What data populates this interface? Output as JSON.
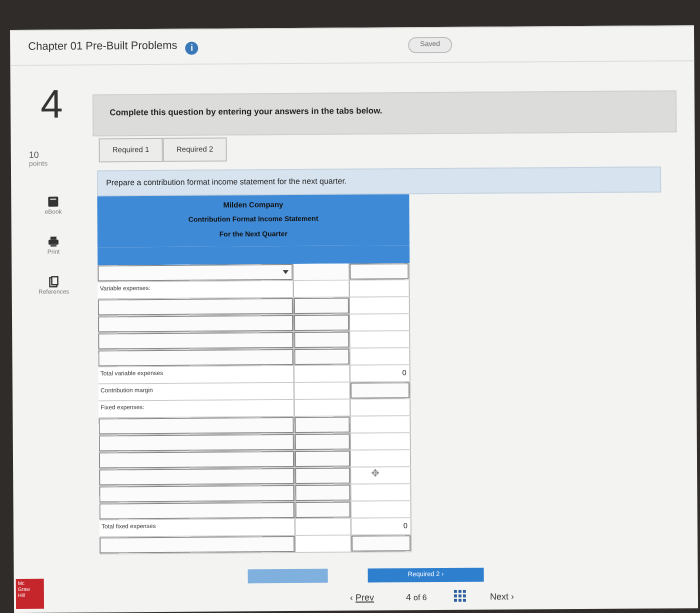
{
  "header": {
    "chapter_title": "Chapter 01 Pre-Built Problems",
    "info_icon": "i",
    "saved_label": "Saved"
  },
  "question": {
    "number": "4",
    "points_value": "10",
    "points_label": "points"
  },
  "sidebar": {
    "tools": [
      {
        "label": "eBook",
        "icon": "book-icon"
      },
      {
        "label": "Print",
        "icon": "printer-icon"
      },
      {
        "label": "References",
        "icon": "references-icon"
      }
    ]
  },
  "instruction": "Complete this question by entering your answers in the tabs below.",
  "tabs": [
    {
      "label": "Required 1"
    },
    {
      "label": "Required 2"
    }
  ],
  "prompt": "Prepare a contribution format income statement for the next quarter.",
  "statement": {
    "company": "Milden Company",
    "title": "Contribution Format Income Statement",
    "period": "For the Next Quarter",
    "variable_expenses_label": "Variable expenses:",
    "total_variable_label": "Total variable expenses",
    "total_variable_value": "0",
    "contribution_margin_label": "Contribution margin",
    "fixed_expenses_label": "Fixed expenses:",
    "total_fixed_label": "Total fixed expenses",
    "total_fixed_value": "0",
    "move_icon": "move-icon"
  },
  "navigation": {
    "required_next": "Required 2",
    "prev": "Prev",
    "page_current": "4",
    "page_of": "of 6",
    "next": "Next"
  },
  "colors": {
    "table_header": "#3f8ad6",
    "prompt_bg": "#d7e3ee",
    "brand_red": "#c5262c"
  }
}
